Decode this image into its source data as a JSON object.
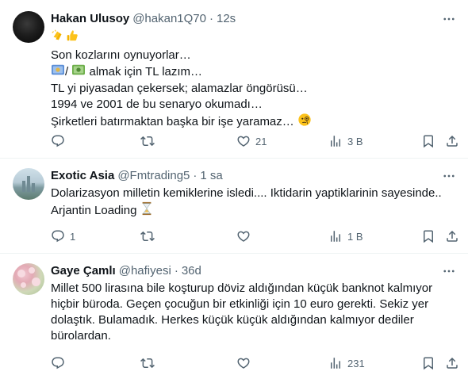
{
  "tweets": [
    {
      "name": "Hakan Ulusoy",
      "handle": "@hakan1Q70",
      "separator": "·",
      "time": "12s",
      "lines": [
        "",
        "Son kozlarını oynuyorlar…",
        "/ almak için TL lazım…",
        "TL yi piyasadan çekersek; alamazlar öngörüsü…",
        "1994 ve 2001 de bu senaryo okumadı…",
        "Şirketleri batırmaktan başka bir işe yaramaz…"
      ],
      "emojis": [
        "clapping-hands",
        "thumbs-up",
        "euro-banknote",
        "dollar-banknote",
        "monocle-face"
      ],
      "reply_count": "",
      "retweet_count": "",
      "like_count": "21",
      "view_count": "3 B"
    },
    {
      "name": "Exotic Asia",
      "handle": "@Fmtrading5",
      "separator": "·",
      "time": "1 sa",
      "lines": [
        "Dolarizasyon milletin kemiklerine isledi.... Iktidarin yaptiklarinin sayesinde..",
        "Arjantin Loading"
      ],
      "emojis": [
        "hourglass"
      ],
      "reply_count": "1",
      "retweet_count": "",
      "like_count": "",
      "view_count": "1 B"
    },
    {
      "name": "Gaye Çamlı",
      "handle": "@hafiyesi",
      "separator": "·",
      "time": "36d",
      "lines": [
        "Millet 500 lirasına bile koşturup döviz aldığından küçük banknot kalmıyor",
        "hiçbir büroda. Geçen çocuğun bir etkinliği için 10 euro gerekti. Sekiz yer",
        "dolaştık. Bulamadık. Herkes küçük küçük aldığından kalmıyor dediler",
        "bürolardan."
      ],
      "emojis": [],
      "reply_count": "",
      "retweet_count": "",
      "like_count": "",
      "view_count": "231"
    }
  ],
  "icons": {
    "more": "more-horizontal-icon",
    "reply": "reply-icon",
    "retweet": "retweet-icon",
    "like": "heart-icon",
    "views": "views-chart-icon",
    "bookmark": "bookmark-icon",
    "share": "share-icon"
  },
  "colors": {
    "text": "#0f1419",
    "secondary": "#536471",
    "divider": "#eff3f4"
  }
}
